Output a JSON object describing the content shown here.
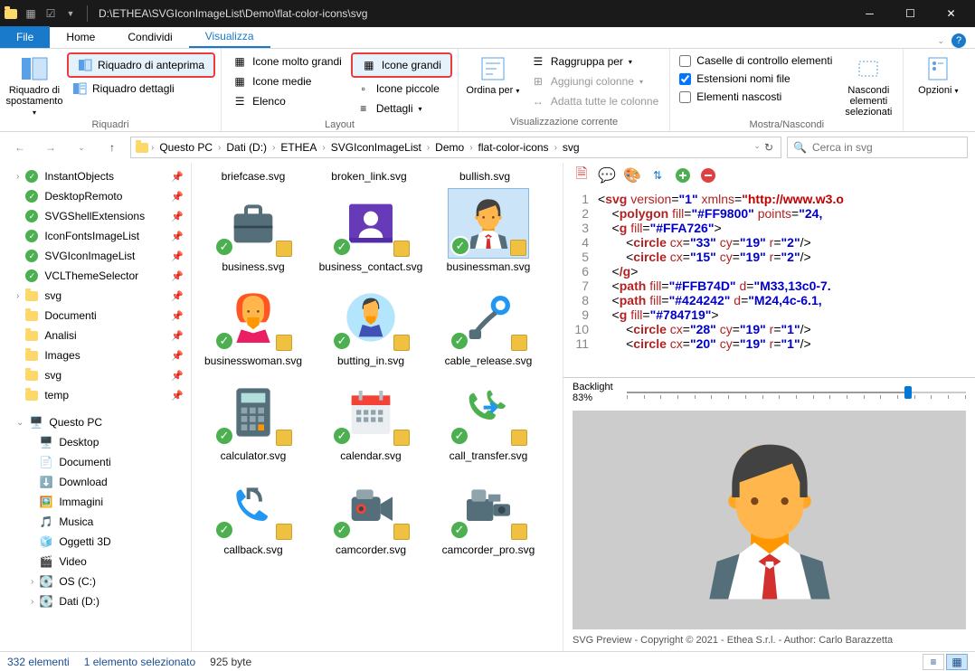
{
  "titlebar": {
    "path": "D:\\ETHEA\\SVGIconImageList\\Demo\\flat-color-icons\\svg"
  },
  "tabs": {
    "file": "File",
    "home": "Home",
    "condividi": "Condividi",
    "visualizza": "Visualizza"
  },
  "ribbon": {
    "riquadri": {
      "riquadro_spostamento": "Riquadro di spostamento",
      "riquadro_anteprima": "Riquadro di anteprima",
      "riquadro_dettagli": "Riquadro dettagli",
      "label": "Riquadri"
    },
    "layout": {
      "icone_molto_grandi": "Icone molto grandi",
      "icone_grandi": "Icone grandi",
      "icone_medie": "Icone medie",
      "icone_piccole": "Icone piccole",
      "elenco": "Elenco",
      "dettagli": "Dettagli",
      "label": "Layout"
    },
    "vis_corr": {
      "ordina_per": "Ordina per",
      "raggruppa_per": "Raggruppa per",
      "aggiungi_colonne": "Aggiungi colonne",
      "adatta_colonne": "Adatta tutte le colonne",
      "label": "Visualizzazione corrente"
    },
    "mostra": {
      "caselle": "Caselle di controllo elementi",
      "estensioni": "Estensioni nomi file",
      "nascosti": "Elementi nascosti",
      "nascondi": "Nascondi elementi selezionati",
      "label": "Mostra/Nascondi"
    },
    "opzioni": "Opzioni"
  },
  "breadcrumb": {
    "questo_pc": "Questo PC",
    "dati": "Dati (D:)",
    "ethea": "ETHEA",
    "svgiconlist": "SVGIconImageList",
    "demo": "Demo",
    "flat": "flat-color-icons",
    "svg": "svg"
  },
  "search": {
    "placeholder": "Cerca in svg"
  },
  "sidebar": {
    "items": [
      {
        "label": "InstantObjects",
        "type": "git",
        "pin": true,
        "exp": true
      },
      {
        "label": "DesktopRemoto",
        "type": "git",
        "pin": true
      },
      {
        "label": "SVGShellExtensions",
        "type": "git",
        "pin": true
      },
      {
        "label": "IconFontsImageList",
        "type": "git",
        "pin": true
      },
      {
        "label": "SVGIconImageList",
        "type": "git",
        "pin": true
      },
      {
        "label": "VCLThemeSelector",
        "type": "git",
        "pin": true
      },
      {
        "label": "svg",
        "type": "folder",
        "pin": true,
        "exp": true
      },
      {
        "label": "Documenti",
        "type": "folder",
        "pin": true
      },
      {
        "label": "Analisi",
        "type": "folder",
        "pin": true
      },
      {
        "label": "Images",
        "type": "folder",
        "pin": true
      },
      {
        "label": "svg",
        "type": "folder",
        "pin": true
      },
      {
        "label": "temp",
        "type": "folder",
        "pin": true
      }
    ],
    "questo_pc": "Questo PC",
    "pc_items": [
      {
        "label": "Desktop",
        "icon": "desktop"
      },
      {
        "label": "Documenti",
        "icon": "doc"
      },
      {
        "label": "Download",
        "icon": "download"
      },
      {
        "label": "Immagini",
        "icon": "pictures"
      },
      {
        "label": "Musica",
        "icon": "music"
      },
      {
        "label": "Oggetti 3D",
        "icon": "3d"
      },
      {
        "label": "Video",
        "icon": "video"
      },
      {
        "label": "OS (C:)",
        "icon": "drive",
        "exp": true
      },
      {
        "label": "Dati (D:)",
        "icon": "drive",
        "exp": true
      }
    ]
  },
  "files": {
    "header": [
      "briefcase.svg",
      "broken_link.svg",
      "bullish.svg"
    ],
    "row1": [
      "business.svg",
      "business_contact.svg",
      "businessman.svg"
    ],
    "row2": [
      "businesswoman.svg",
      "butting_in.svg",
      "cable_release.svg"
    ],
    "row3": [
      "calculator.svg",
      "calendar.svg",
      "call_transfer.svg"
    ],
    "row4": [
      "callback.svg",
      "camcorder.svg",
      "camcorder_pro.svg"
    ]
  },
  "preview": {
    "backlight_label": "Backlight",
    "backlight_value": "83%",
    "footer": "SVG Preview - Copyright © 2021 - Ethea S.r.l. - Author: Carlo Barazzetta"
  },
  "status": {
    "elementi": "332 elementi",
    "selezionato": "1 elemento selezionato",
    "size": "925 byte"
  },
  "code": {
    "l1": {
      "tag": "svg",
      "a1": "version",
      "v1": "\"1\"",
      "a2": "xmlns",
      "v2": "\"http://www.w3.o"
    },
    "l2": {
      "tag": "polygon",
      "a1": "fill",
      "v1": "\"#FF9800\"",
      "a2": "points",
      "v2": "\"24,"
    },
    "l3": {
      "tag": "g",
      "a1": "fill",
      "v1": "\"#FFA726\""
    },
    "l4": {
      "tag": "circle",
      "a1": "cx",
      "v1": "\"33\"",
      "a2": "cy",
      "v2": "\"19\"",
      "a3": "r",
      "v3": "\"2\""
    },
    "l5": {
      "tag": "circle",
      "a1": "cx",
      "v1": "\"15\"",
      "a2": "cy",
      "v2": "\"19\"",
      "a3": "r",
      "v3": "\"2\""
    },
    "l6": {
      "tag": "/g"
    },
    "l7": {
      "tag": "path",
      "a1": "fill",
      "v1": "\"#FFB74D\"",
      "a2": "d",
      "v2": "\"M33,13c0-7."
    },
    "l8": {
      "tag": "path",
      "a1": "fill",
      "v1": "\"#424242\"",
      "a2": "d",
      "v2": "\"M24,4c-6.1,"
    },
    "l9": {
      "tag": "g",
      "a1": "fill",
      "v1": "\"#784719\""
    },
    "l10": {
      "tag": "circle",
      "a1": "cx",
      "v1": "\"28\"",
      "a2": "cy",
      "v2": "\"19\"",
      "a3": "r",
      "v3": "\"1\""
    },
    "l11": {
      "tag": "circle",
      "a1": "cx",
      "v1": "\"20\"",
      "a2": "cy",
      "v2": "\"19\"",
      "a3": "r",
      "v3": "\"1\""
    }
  }
}
